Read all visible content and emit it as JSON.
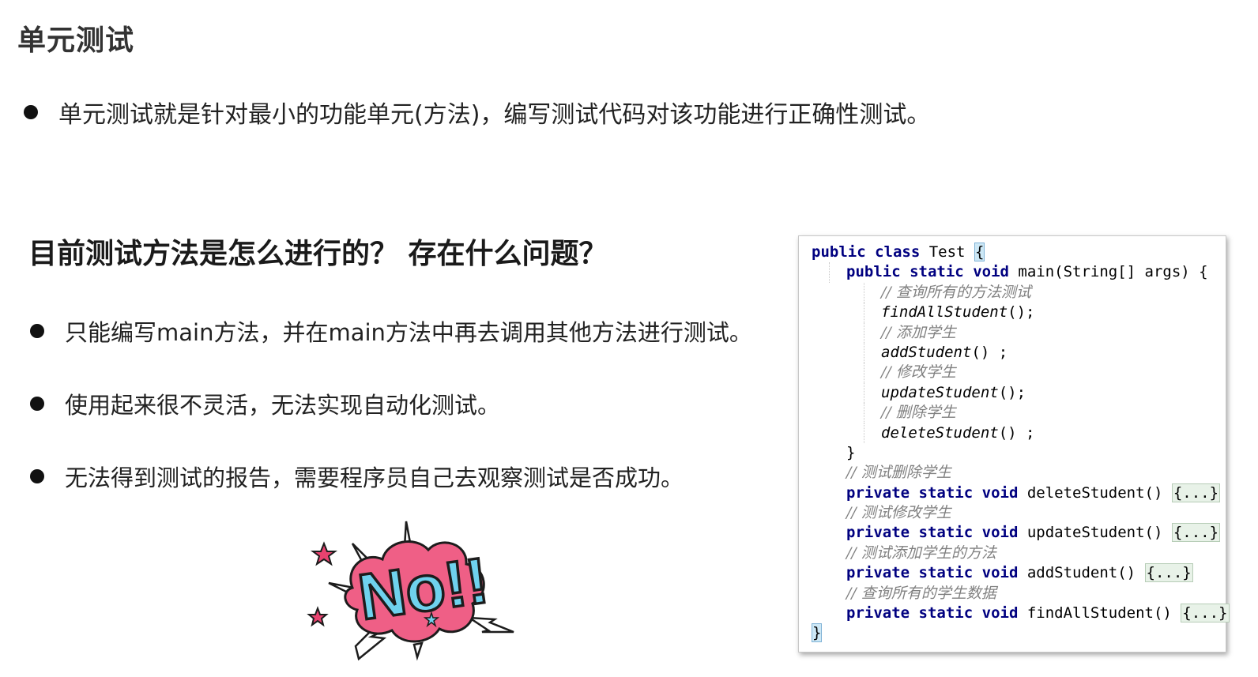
{
  "title": "单元测试",
  "intro": {
    "text": "单元测试就是针对最小的功能单元(方法)，编写测试代码对该功能进行正确性测试。"
  },
  "question": {
    "heading": "目前测试方法是怎么进行的？ 存在什么问题？"
  },
  "issues": [
    "只能编写main方法，并在main方法中再去调用其他方法进行测试。",
    "使用起来很不灵活，无法实现自动化测试。",
    "无法得到测试的报告，需要程序员自己去观察测试是否成功。"
  ],
  "sticker": {
    "text": "No!!",
    "colors": {
      "cloud": "#ef5f86",
      "letters": "#6fd2ee",
      "outline": "#1c1c1c",
      "star": "#e8426f"
    }
  },
  "code": {
    "class_decl": {
      "kw1": "public",
      "kw2": "class",
      "name": " Test ",
      "brace": "{"
    },
    "main_decl": {
      "kw1": "public",
      "kw2": "static",
      "kw3": "void",
      "rest": " main(String[] args) {"
    },
    "main_body": [
      {
        "comment": "// 查询所有的方法测试",
        "call": "findAllStudent",
        "tail": "();"
      },
      {
        "comment": "// 添加学生",
        "call": "addStudent",
        "tail": "() ;"
      },
      {
        "comment": "// 修改学生",
        "call": "updateStudent",
        "tail": "();"
      },
      {
        "comment": "// 删除学生",
        "call": "deleteStudent",
        "tail": "() ;"
      }
    ],
    "main_close": "}",
    "methods": [
      {
        "comment": "// 测试删除学生",
        "kw1": "private",
        "kw2": "static",
        "kw3": "void",
        "sig": " deleteStudent() ",
        "fold": "{...}"
      },
      {
        "comment": "// 测试修改学生",
        "kw1": "private",
        "kw2": "static",
        "kw3": "void",
        "sig": " updateStudent() ",
        "fold": "{...}"
      },
      {
        "comment": "// 测试添加学生的方法",
        "kw1": "private",
        "kw2": "static",
        "kw3": "void",
        "sig": " addStudent() ",
        "fold": "{...}"
      },
      {
        "comment": "// 查询所有的学生数据",
        "kw1": "private",
        "kw2": "static",
        "kw3": "void",
        "sig": " findAllStudent() ",
        "fold": "{...}"
      }
    ],
    "class_close": "}"
  }
}
